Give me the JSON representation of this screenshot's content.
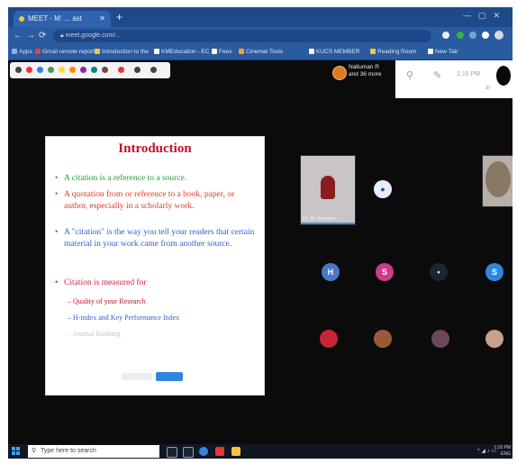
{
  "browser": {
    "tab_title": "MEET - M: ... ast",
    "url": "meet.google.com/...",
    "bookmarks": [
      "Apps",
      "Gmail remote report",
      "Introduction to the",
      "KMEducation - EC",
      "Fees",
      "Cinemat Tools",
      "KUCS MEMBER",
      "Reading Room",
      "New Tab"
    ]
  },
  "meet": {
    "presenter": {
      "name_line1": "Nalluman R",
      "name_line2": "and 36 more"
    },
    "time": "1:16 PM",
    "participant_count": "37"
  },
  "slide": {
    "title": "Introduction",
    "bullets": [
      {
        "text": "A citation is a reference to a source.",
        "color": "#1fa23a"
      },
      {
        "text": "A quotation from or reference to a book, paper, or author, especially in a scholarly work.",
        "color": "#e03a1f"
      },
      {
        "text": "A \"citation\" is the way you tell your readers that certain material in your work came from another source.",
        "color": "#2f5fd0"
      },
      {
        "text": "Citation is measured for",
        "color": "#d81b3a"
      }
    ],
    "sub_items": [
      {
        "text": "– Quality of your Research",
        "color": "#c0102a"
      },
      {
        "text": "– H-index and Key Performance Index",
        "color": "#2f5fd0"
      },
      {
        "text": "– Journal Ranking",
        "color": "#c0c4cc"
      }
    ]
  },
  "participants": {
    "cam1_label": "Dr. M. Suresha..."
  },
  "taskbar": {
    "search_placeholder": "Type here to search",
    "clock_time": "1:16 PM",
    "clock_date": "ENG"
  },
  "colors": {
    "tabbar": "#1e4a8a",
    "browserbar": "#2a5aa0",
    "meet_bg": "#0b0b0b",
    "title_red": "#c0102a"
  },
  "icons": [
    "chrome-icon",
    "back-icon",
    "forward-icon",
    "reload-icon",
    "lock-icon",
    "star-icon",
    "profile-icon",
    "people-icon",
    "chat-icon",
    "windows-icon",
    "search-icon"
  ]
}
